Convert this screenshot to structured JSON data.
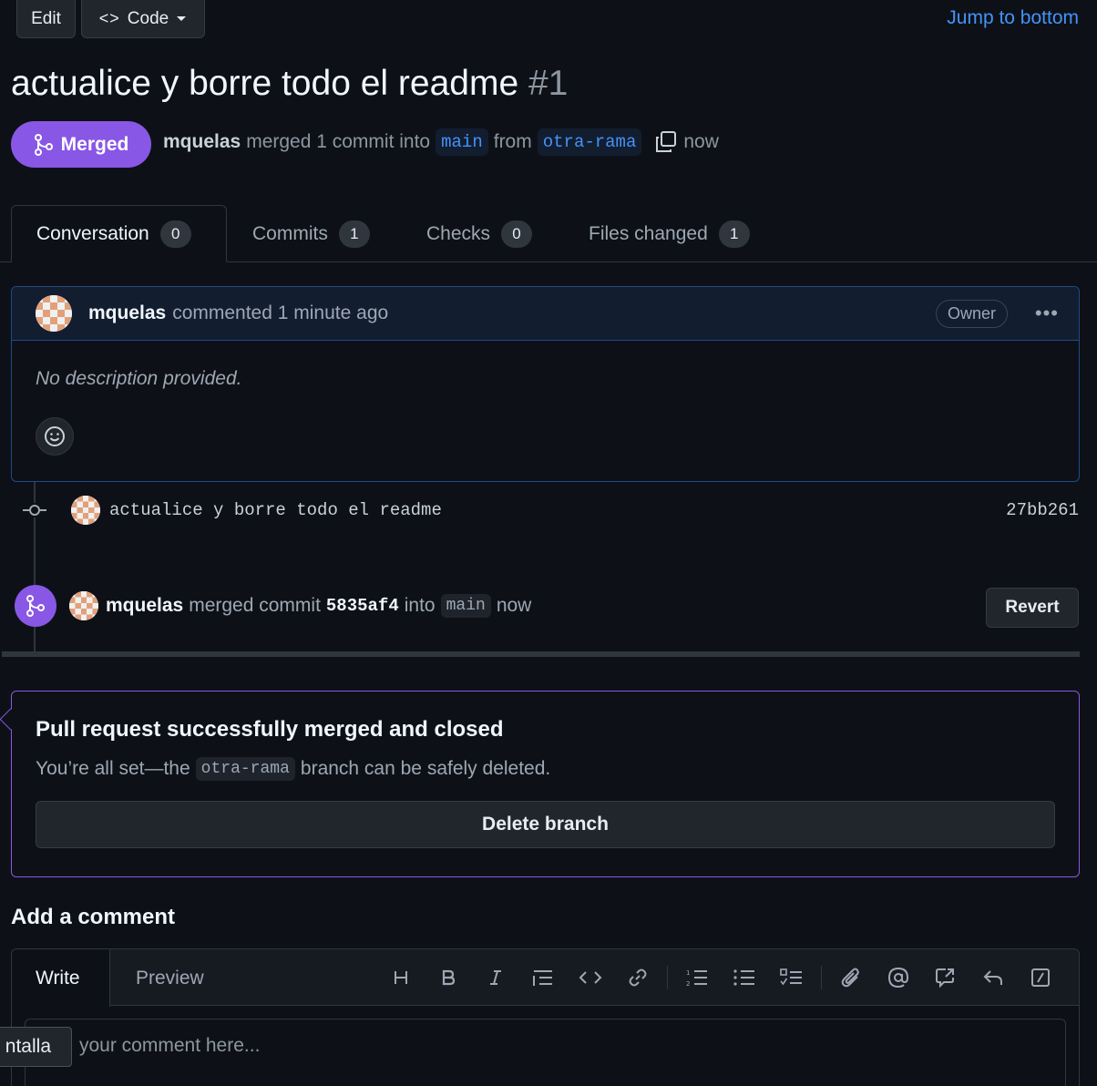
{
  "header": {
    "edit_label": "Edit",
    "code_label": "Code",
    "jump_label": "Jump to bottom"
  },
  "pr": {
    "title": "actualice y borre todo el readme",
    "number": "#1",
    "state": "Merged",
    "author": "mquelas",
    "merged_text": "merged 1 commit into",
    "base_branch": "main",
    "from_text": "from",
    "head_branch": "otra-rama",
    "time": "now"
  },
  "tabs": [
    {
      "label": "Conversation",
      "count": "0"
    },
    {
      "label": "Commits",
      "count": "1"
    },
    {
      "label": "Checks",
      "count": "0"
    },
    {
      "label": "Files changed",
      "count": "1"
    }
  ],
  "comment": {
    "author": "mquelas",
    "action": "commented 1 minute ago",
    "badge": "Owner",
    "body": "No description provided."
  },
  "commit": {
    "message": "actualice y borre todo el readme",
    "sha": "27bb261"
  },
  "merge_event": {
    "author": "mquelas",
    "text1": "merged commit",
    "sha": "5835af4",
    "text2": "into",
    "branch": "main",
    "time": "now",
    "revert_label": "Revert"
  },
  "merged_box": {
    "title": "Pull request successfully merged and closed",
    "desc_before": "You’re all set—the",
    "branch": "otra-rama",
    "desc_after": "branch can be safely deleted.",
    "delete_label": "Delete branch"
  },
  "add_comment": {
    "title": "Add a comment",
    "write_tab": "Write",
    "preview_tab": "Preview",
    "placeholder": "your comment here...",
    "tooltip": "ntalla"
  },
  "colors": {
    "background": "#0d1117",
    "merged_purple": "#8957e5",
    "link_blue": "#4493f8",
    "comment_header": "#121d2f"
  },
  "toolbar_icons": [
    "heading-icon",
    "bold-icon",
    "italic-icon",
    "quote-icon",
    "code-icon",
    "link-icon",
    "ordered-list-icon",
    "unordered-list-icon",
    "task-list-icon",
    "attach-icon",
    "mention-icon",
    "reference-icon",
    "reply-icon",
    "slash-command-icon"
  ]
}
